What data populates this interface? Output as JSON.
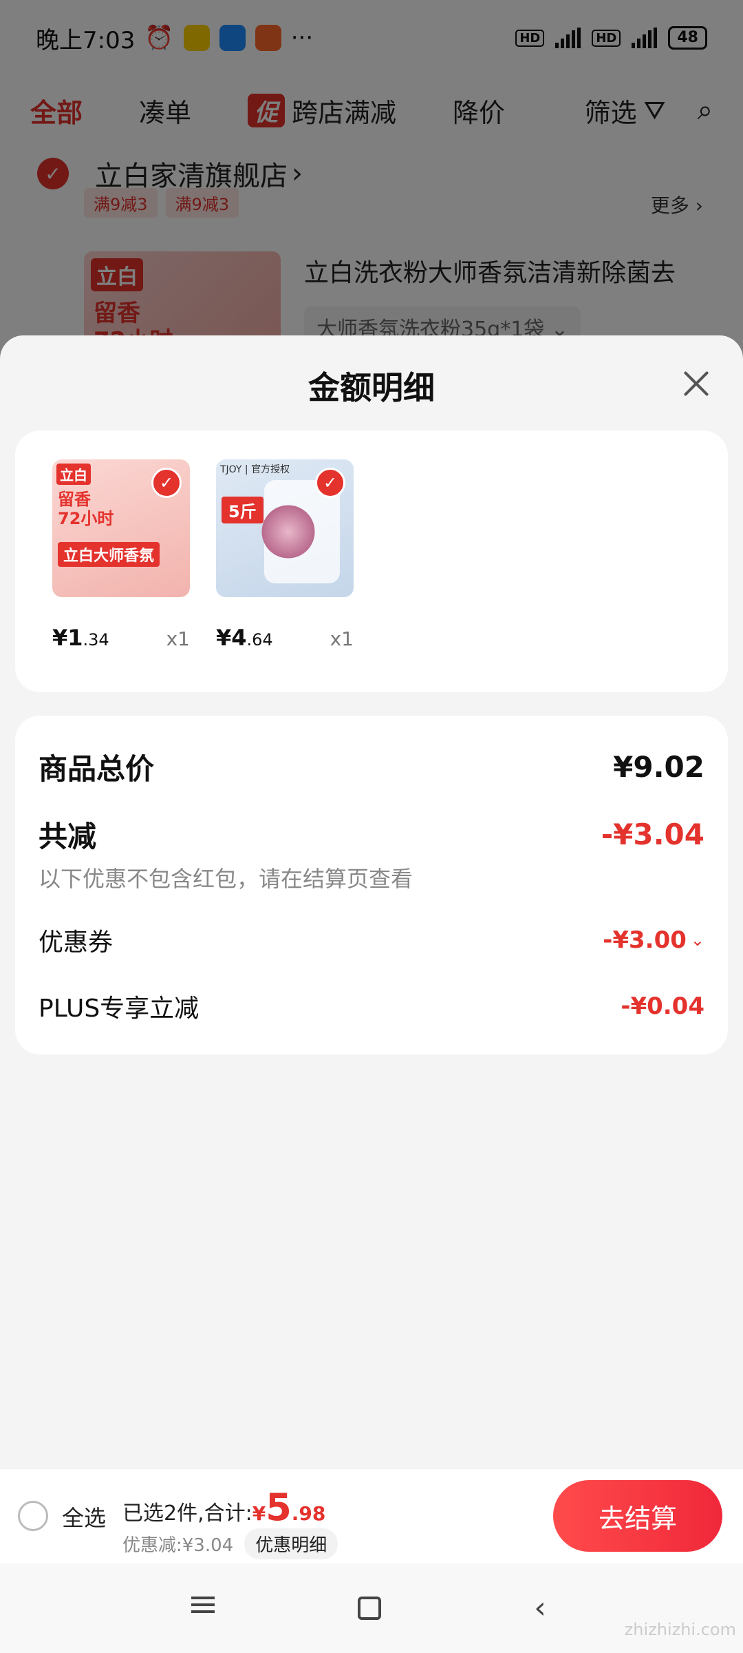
{
  "status_bar": {
    "time": "晚上7:03",
    "battery": "48"
  },
  "tabs": [
    {
      "label": "全部"
    },
    {
      "label": "凑单"
    },
    {
      "label": "跨店满减",
      "badge": "促"
    },
    {
      "label": "降价"
    },
    {
      "label": "筛选"
    }
  ],
  "store": {
    "name": "立白家清旗舰店",
    "tags": [
      "满9减3",
      "满9减3"
    ],
    "more": "更多",
    "product_title": "立白洗衣粉大师香氛洁清新除菌去",
    "product_spec": "大师香氛洗衣粉35g*1袋",
    "img_logo": "立白",
    "img_text": "留香\n72小时"
  },
  "sheet": {
    "title": "金额明细",
    "products": [
      {
        "img_logo": "立白",
        "img_text": "留香\n72小时",
        "img_badge": "立白大师香氛",
        "price_int": "¥1",
        "price_dec": ".34",
        "qty": "x1"
      },
      {
        "img_tjoy": "TJOY | 官方授权",
        "img_badge": "5斤",
        "price_int": "¥4",
        "price_dec": ".64",
        "qty": "x1"
      }
    ],
    "summary": {
      "total_label": "商品总价",
      "total_value": "¥9.02",
      "reduce_label": "共减",
      "reduce_value": "-¥3.04",
      "note": "以下优惠不包含红包，请在结算页查看",
      "coupon_label": "优惠券",
      "coupon_value": "-¥3.00",
      "plus_label": "PLUS专享立减",
      "plus_value": "-¥0.04"
    }
  },
  "checkout": {
    "select_all": "全选",
    "selected_text": "已选2件,合计:",
    "total_currency": "¥",
    "total_int": "5",
    "total_dec": ".98",
    "discount_text": "优惠减:¥3.04",
    "detail_button": "优惠明细",
    "checkout_button": "去结算"
  },
  "watermark": "zhizhizhi.com",
  "colors": {
    "accent": "#e4322d",
    "checkout": "#f0283a"
  }
}
